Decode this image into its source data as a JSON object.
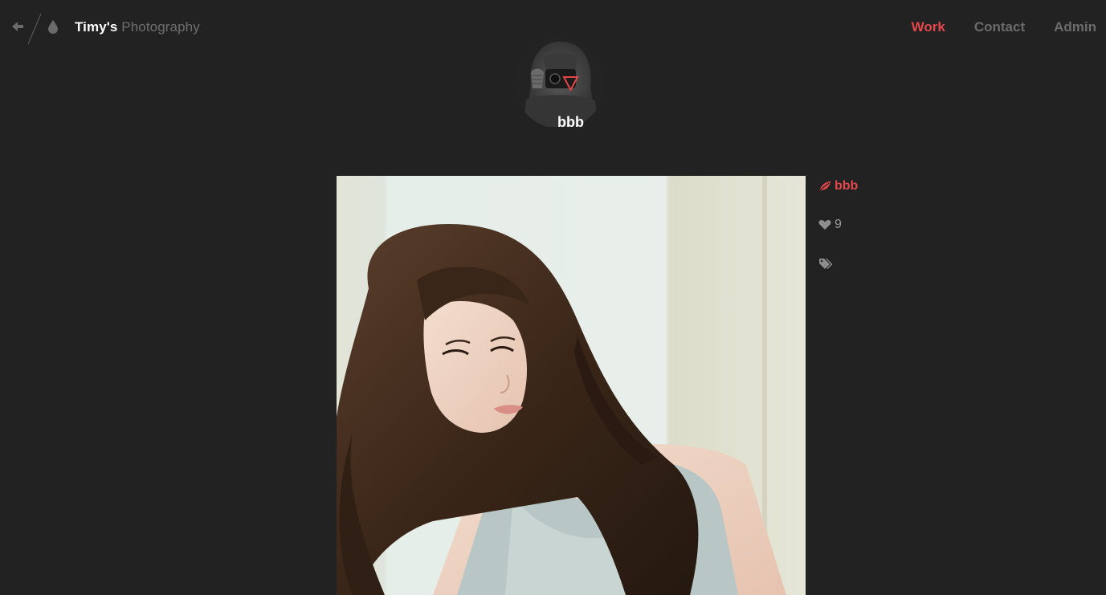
{
  "header": {
    "brand_owner": "Timy's",
    "brand_suffix": "Photography",
    "nav": [
      {
        "label": "Work",
        "active": true
      },
      {
        "label": "Contact",
        "active": false
      },
      {
        "label": "Admin",
        "active": false
      }
    ],
    "back_icon": "arrow-left-icon",
    "logo_icon": "drop-icon"
  },
  "author": {
    "name": "bbb",
    "avatar_icon": "avatar-photographer"
  },
  "photo": {
    "title": "bbb",
    "likes": "9",
    "title_icon": "leaf-icon",
    "likes_icon": "heart-icon",
    "tags_icon": "tags-icon"
  },
  "colors": {
    "accent": "#e2474b",
    "background": "#222222",
    "muted": "#6b6b6b"
  }
}
